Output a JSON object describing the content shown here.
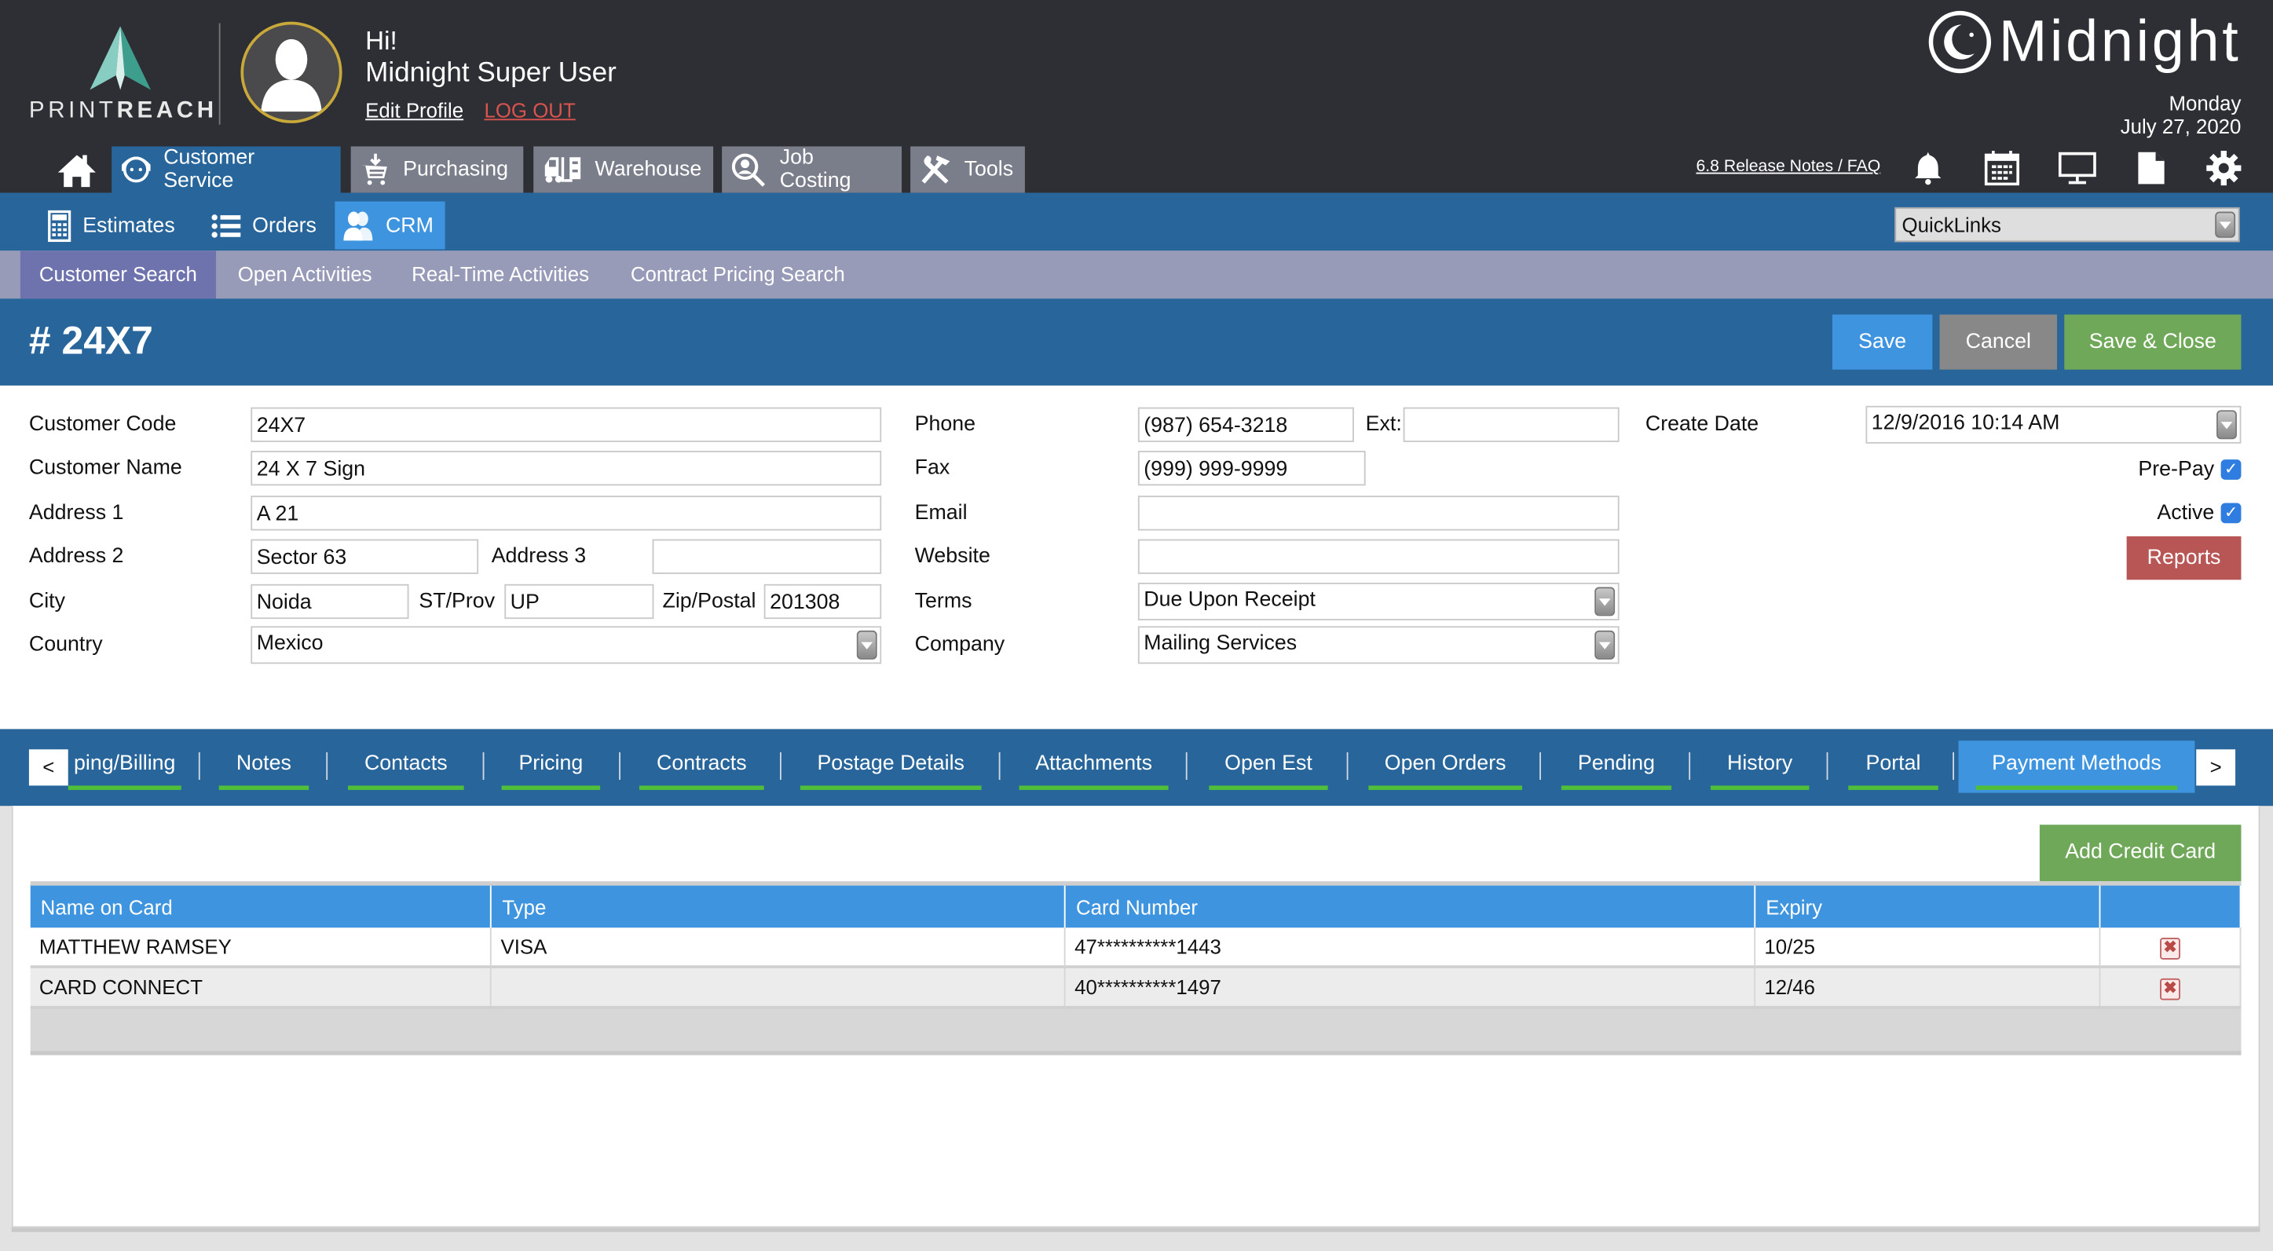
{
  "header": {
    "logo_thin": "PRINT",
    "logo_bold": "REACH",
    "greeting": "Hi!",
    "user_name": "Midnight Super User",
    "edit_profile": "Edit Profile",
    "log_out": "LOG OUT",
    "brand": "Midnight",
    "day": "Monday",
    "date": "July 27, 2020",
    "release_notes": "6.8 Release Notes / FAQ",
    "icons": [
      "bell-icon",
      "calendar-icon",
      "monitor-icon",
      "document-icon",
      "gear-icon"
    ]
  },
  "main_nav": [
    {
      "label": "Customer Service",
      "icon": "headset-icon",
      "active": true
    },
    {
      "label": "Purchasing",
      "icon": "cart-icon",
      "active": false
    },
    {
      "label": "Warehouse",
      "icon": "forklift-icon",
      "active": false
    },
    {
      "label": "Job Costing",
      "icon": "search-person-icon",
      "active": false
    },
    {
      "label": "Tools",
      "icon": "tools-icon",
      "active": false
    }
  ],
  "sub_nav": [
    {
      "label": "Estimates",
      "icon": "calculator-icon",
      "active": false
    },
    {
      "label": "Orders",
      "icon": "list-icon",
      "active": false
    },
    {
      "label": "CRM",
      "icon": "people-icon",
      "active": true
    }
  ],
  "quicklinks": {
    "value": "QuickLinks"
  },
  "third_nav": [
    {
      "label": "Customer Search",
      "active": true
    },
    {
      "label": "Open Activities",
      "active": false
    },
    {
      "label": "Real-Time Activities",
      "active": false
    },
    {
      "label": "Contract Pricing Search",
      "active": false
    }
  ],
  "page": {
    "title": "# 24X7",
    "buttons": {
      "save": "Save",
      "cancel": "Cancel",
      "save_close": "Save & Close"
    }
  },
  "colors": {
    "save": "#3e94de",
    "cancel": "#888888",
    "save_close": "#6fa858",
    "reports": "#b85555",
    "add_card": "#6fa858",
    "nav_blue": "#28659a",
    "active_blue": "#3e94de",
    "tab_underline": "#4fbf3a"
  },
  "form": {
    "customer_code": {
      "label": "Customer Code",
      "value": "24X7"
    },
    "customer_name": {
      "label": "Customer Name",
      "value": "24 X 7 Sign"
    },
    "address1": {
      "label": "Address 1",
      "value": "A 21"
    },
    "address2": {
      "label": "Address 2",
      "value": "Sector 63"
    },
    "address3": {
      "label": "Address 3",
      "value": ""
    },
    "city": {
      "label": "City",
      "value": "Noida"
    },
    "st_prov": {
      "label": "ST/Prov",
      "value": "UP"
    },
    "zip": {
      "label": "Zip/Postal",
      "value": "201308"
    },
    "country": {
      "label": "Country",
      "value": "Mexico"
    },
    "phone": {
      "label": "Phone",
      "value": "(987) 654-3218"
    },
    "ext": {
      "label": "Ext:",
      "value": ""
    },
    "fax": {
      "label": "Fax",
      "value": "(999) 999-9999"
    },
    "email": {
      "label": "Email",
      "value": ""
    },
    "website": {
      "label": "Website",
      "value": ""
    },
    "terms": {
      "label": "Terms",
      "value": "Due Upon Receipt"
    },
    "company": {
      "label": "Company",
      "value": "Mailing Services"
    },
    "create_date": {
      "label": "Create Date",
      "value": "12/9/2016 10:14 AM"
    },
    "prepay": {
      "label": "Pre-Pay",
      "checked": true
    },
    "active": {
      "label": "Active",
      "checked": true
    },
    "reports_button": "Reports"
  },
  "tabs": {
    "prev": "<",
    "next": ">",
    "items": [
      {
        "label": "ping/Billing",
        "active": false
      },
      {
        "label": "Notes",
        "active": false
      },
      {
        "label": "Contacts",
        "active": false
      },
      {
        "label": "Pricing",
        "active": false
      },
      {
        "label": "Contracts",
        "active": false
      },
      {
        "label": "Postage Details",
        "active": false
      },
      {
        "label": "Attachments",
        "active": false
      },
      {
        "label": "Open Est",
        "active": false
      },
      {
        "label": "Open Orders",
        "active": false
      },
      {
        "label": "Pending",
        "active": false
      },
      {
        "label": "History",
        "active": false
      },
      {
        "label": "Portal",
        "active": false
      },
      {
        "label": "Payment Methods",
        "active": true
      }
    ]
  },
  "payment_methods": {
    "add_button": "Add Credit Card",
    "columns": [
      "Name on Card",
      "Type",
      "Card Number",
      "Expiry",
      ""
    ],
    "rows": [
      {
        "name": "MATTHEW RAMSEY",
        "type": "VISA",
        "card_number": "47**********1443",
        "expiry": "10/25",
        "action": "delete-icon"
      },
      {
        "name": "CARD CONNECT",
        "type": "",
        "card_number": "40**********1497",
        "expiry": "12/46",
        "action": "delete-icon"
      }
    ]
  }
}
